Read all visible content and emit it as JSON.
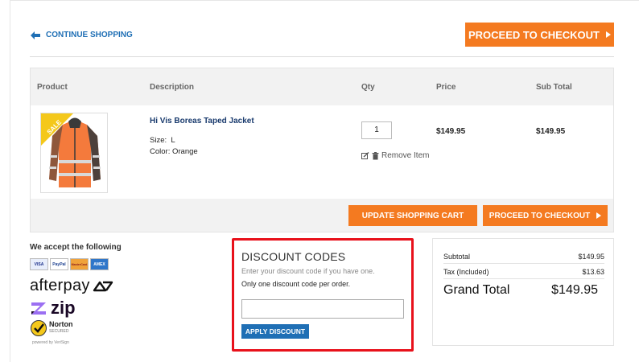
{
  "nav": {
    "continue_label": "CONTINUE SHOPPING",
    "checkout_label": "PROCEED TO CHECKOUT"
  },
  "cart": {
    "columns": [
      "Product",
      "Description",
      "Qty",
      "Price",
      "Sub Total"
    ],
    "items": [
      {
        "badge": "SALE",
        "name": "Hi Vis Boreas Taped Jacket",
        "size_label": "Size:",
        "size": "L",
        "color_label": "Color:",
        "color": "Orange",
        "qty": "1",
        "remove_label": "Remove Item",
        "price": "$149.95",
        "subtotal": "$149.95"
      }
    ],
    "update_label": "UPDATE SHOPPING CART",
    "checkout_label": "PROCEED TO CHECKOUT"
  },
  "payments": {
    "title": "We accept the following",
    "cards": [
      "VISA",
      "PayPal",
      "MasterCard",
      "AMEX"
    ],
    "afterpay": "afterpay",
    "zip": "zip",
    "norton": "Norton",
    "norton_sub": "SECURED",
    "powered_by": "powered by VeriSign"
  },
  "discount": {
    "title": "DISCOUNT CODES",
    "hint": "Enter your discount code if you have one.",
    "note": "Only one discount code per order.",
    "input_value": "",
    "apply_label": "APPLY DISCOUNT"
  },
  "totals": {
    "subtotal_label": "Subtotal",
    "subtotal": "$149.95",
    "tax_label": "Tax (Included)",
    "tax": "$13.63",
    "grand_label": "Grand Total",
    "grand": "$149.95"
  },
  "colors": {
    "accent_orange": "#f47a20",
    "link_blue": "#1f6fb5",
    "highlight_red": "#e8111b"
  }
}
